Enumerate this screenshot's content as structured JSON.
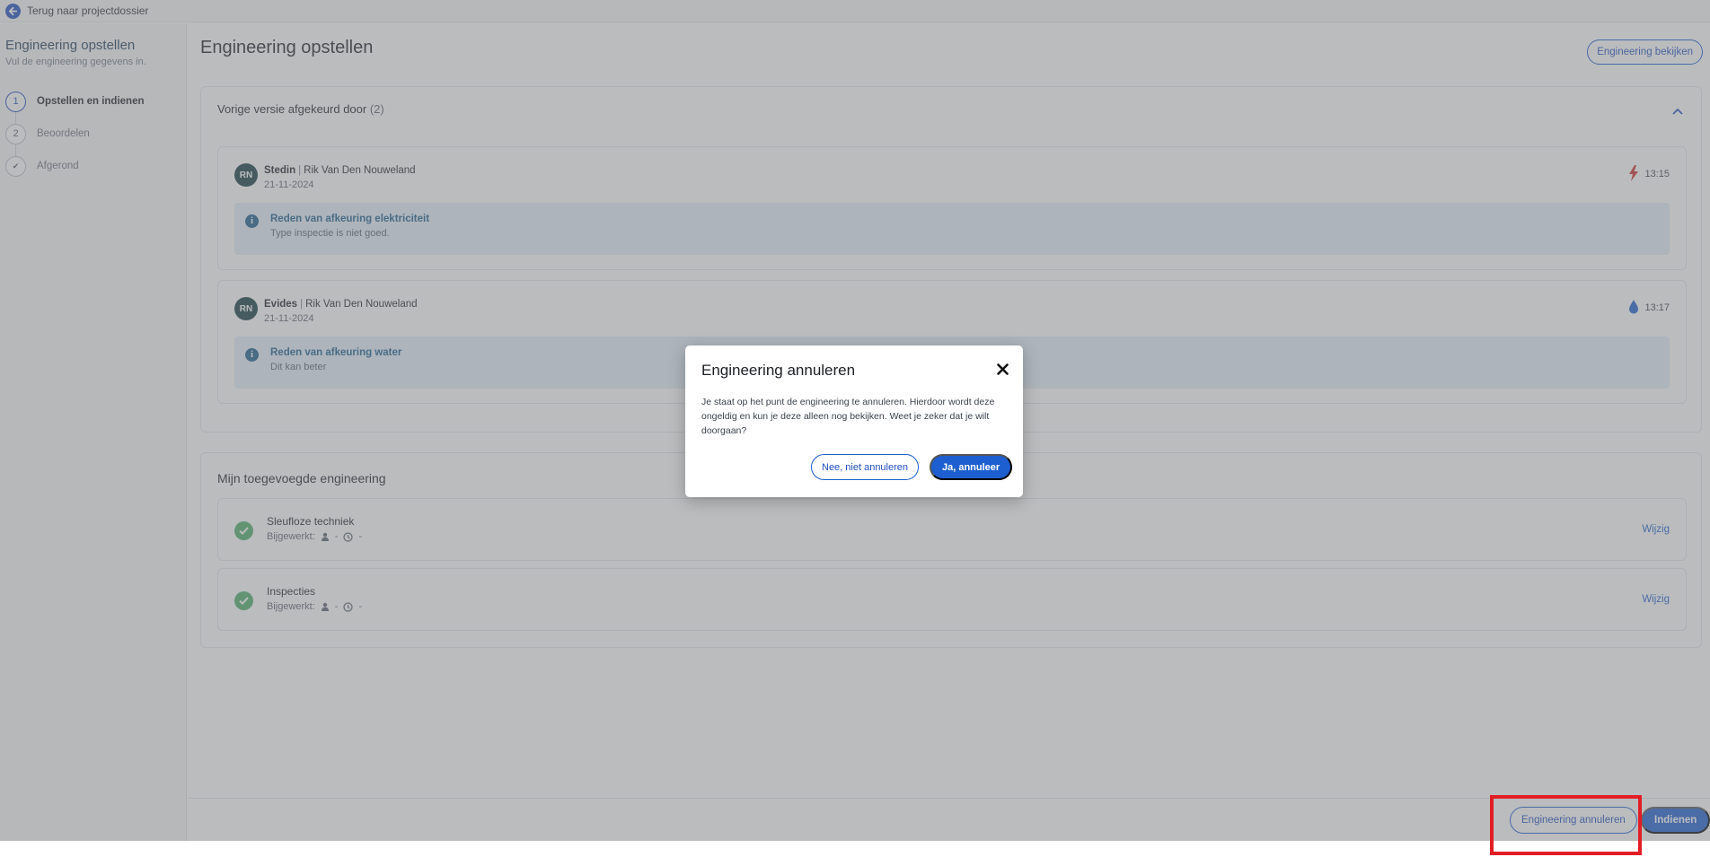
{
  "topbar": {
    "back_label": "Terug naar projectdossier",
    "icon": "arrow-left-icon"
  },
  "sidebar": {
    "title": "Engineering opstellen",
    "subtitle": "Vul de engineering gegevens in.",
    "steps": [
      {
        "marker": "1",
        "label": "Opstellen en indienen",
        "state": "active"
      },
      {
        "marker": "2",
        "label": "Beoordelen",
        "state": "pending"
      },
      {
        "marker": "✔",
        "label": "Afgerond",
        "state": "pending"
      }
    ]
  },
  "main": {
    "title": "Engineering opstellen",
    "view_button": "Engineering bekijken",
    "rejections": {
      "heading": "Vorige versie afgekeurd door",
      "count": "(2)",
      "entries": [
        {
          "initials": "RN",
          "org": "Stedin",
          "separator": "|",
          "person": "Rik Van Den Nouweland",
          "date": "21-11-2024",
          "time": "13:15",
          "utility_icon": "lightning-icon",
          "reason_title": "Reden van afkeuring elektriciteit",
          "reason_text": "Type inspectie is niet goed."
        },
        {
          "initials": "RN",
          "org": "Evides",
          "separator": "|",
          "person": "Rik Van Den Nouweland",
          "date": "21-11-2024",
          "time": "13:17",
          "utility_icon": "water-drop-icon",
          "reason_title": "Reden van afkeuring water",
          "reason_text": "Dit kan beter"
        }
      ]
    },
    "engineering": {
      "title": "Mijn toegevoegde engineering",
      "items": [
        {
          "name": "Sleufloze techniek",
          "updated_label": "Bijgewerkt:",
          "user": "-",
          "time": "-",
          "action": "Wijzig"
        },
        {
          "name": "Inspecties",
          "updated_label": "Bijgewerkt:",
          "user": "-",
          "time": "-",
          "action": "Wijzig"
        }
      ]
    }
  },
  "footer": {
    "cancel_label": "Engineering annuleren",
    "submit_label": "Indienen"
  },
  "modal": {
    "title": "Engineering annuleren",
    "text": "Je staat op het punt de engineering te annuleren. Hierdoor wordt deze ongeldig en kun je deze alleen nog bekijken. Weet je zeker dat je wilt doorgaan?",
    "cancel_label": "Nee, niet annuleren",
    "confirm_label": "Ja, annuleer"
  },
  "colors": {
    "primary": "#1d5fd0",
    "highlight": "#e21d25",
    "success": "#4caf6a",
    "info": "#1b5e8c"
  }
}
